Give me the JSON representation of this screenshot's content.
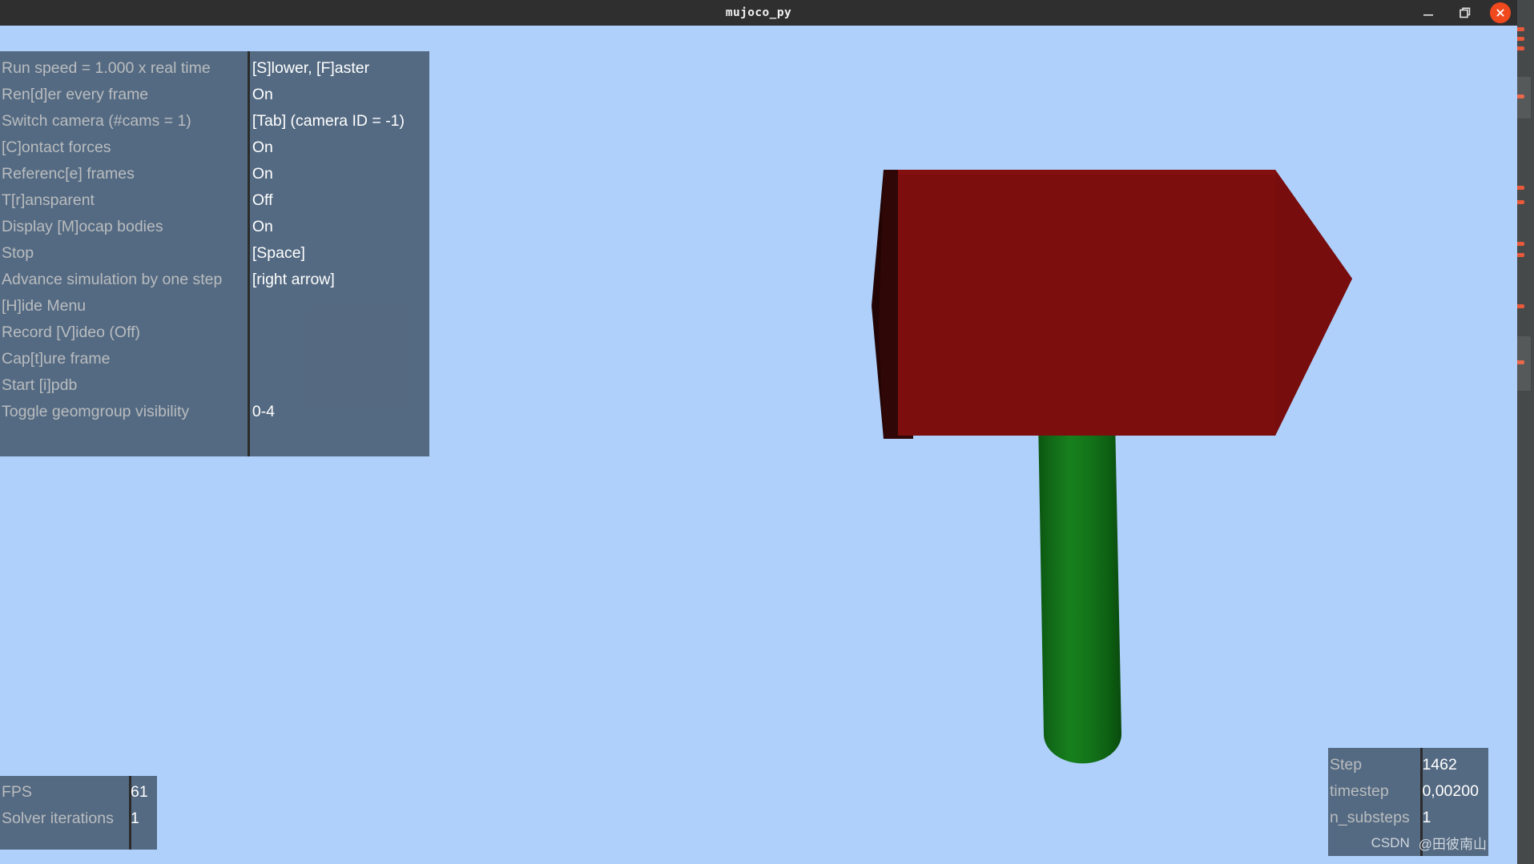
{
  "window": {
    "title": "mujoco_py",
    "controls": {
      "minimize": "minimize-icon",
      "maximize": "maximize-icon",
      "close": "close-icon"
    }
  },
  "viewport": {
    "background_color": "#aed0fb",
    "objects": [
      {
        "name": "hammer-head",
        "type": "box",
        "color": "#7a0d0d",
        "shade_dark": "#260505",
        "shade_side": "#6b0b0b"
      },
      {
        "name": "hammer-handle",
        "type": "capsule",
        "color": "#14741a",
        "shade_dark": "#0a4a10",
        "shade_light": "#1b8a22"
      }
    ]
  },
  "menu": {
    "rows": [
      {
        "label": "Run speed = 1.000 x real time",
        "value": "[S]lower, [F]aster"
      },
      {
        "label": "Ren[d]er every frame",
        "value": "On"
      },
      {
        "label": "Switch camera (#cams = 1)",
        "value": "[Tab] (camera ID = -1)"
      },
      {
        "label": "[C]ontact forces",
        "value": "On"
      },
      {
        "label": "Referenc[e] frames",
        "value": "On"
      },
      {
        "label": "T[r]ansparent",
        "value": "Off"
      },
      {
        "label": "Display [M]ocap bodies",
        "value": "On"
      },
      {
        "label": "Stop",
        "value": "[Space]"
      },
      {
        "label": "Advance simulation by one step",
        "value": "[right arrow]"
      },
      {
        "label": "[H]ide Menu",
        "value": ""
      },
      {
        "label": "Record [V]ideo (Off)",
        "value": ""
      },
      {
        "label": "Cap[t]ure frame",
        "value": ""
      },
      {
        "label": "Start [i]pdb",
        "value": ""
      },
      {
        "label": "Toggle geomgroup visibility",
        "value": "0-4"
      }
    ]
  },
  "fps_panel": {
    "rows": [
      {
        "label": "FPS",
        "value": "61"
      },
      {
        "label": "Solver iterations",
        "value": "1"
      }
    ]
  },
  "step_panel": {
    "rows": [
      {
        "label": "Step",
        "value": "1462"
      },
      {
        "label": "timestep",
        "value": "0,00200"
      },
      {
        "label": "n_substeps",
        "value": "1"
      }
    ]
  },
  "watermark": {
    "left": "CSDN",
    "right": "@田彼南山"
  }
}
